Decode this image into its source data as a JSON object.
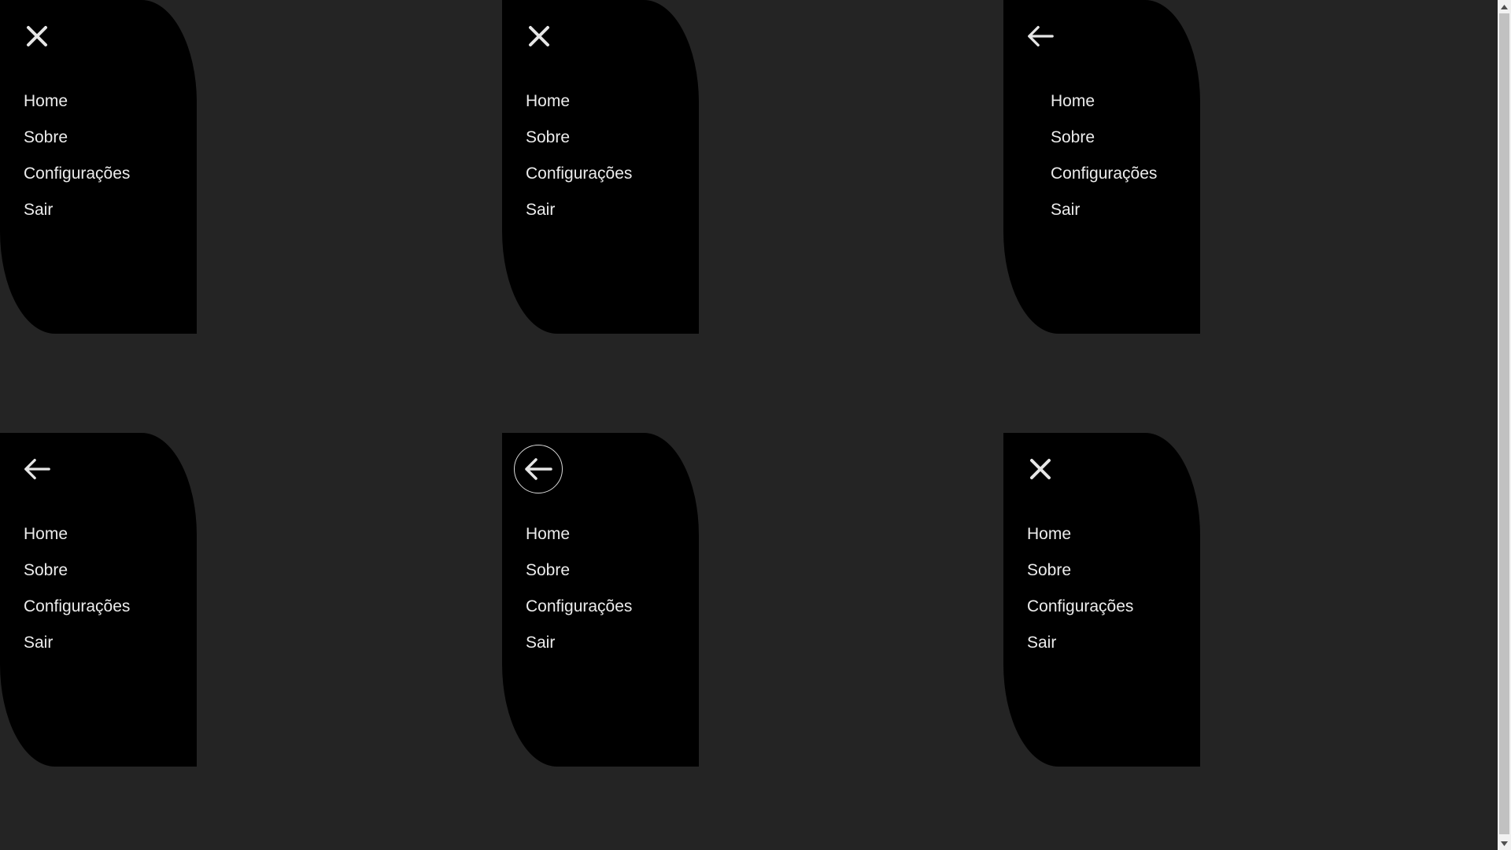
{
  "panels": [
    {
      "icon": "close-icon",
      "items": [
        "Home",
        "Sobre",
        "Configurações",
        "Sair"
      ]
    },
    {
      "icon": "close-icon",
      "items": [
        "Home",
        "Sobre",
        "Configurações",
        "Sair"
      ]
    },
    {
      "icon": "arrow-left-icon",
      "items": [
        "Home",
        "Sobre",
        "Configurações",
        "Sair"
      ]
    },
    {
      "icon": "arrow-left-icon",
      "items": [
        "Home",
        "Sobre",
        "Configurações",
        "Sair"
      ]
    },
    {
      "icon": "arrow-left-circle-icon",
      "items": [
        "Home",
        "Sobre",
        "Configurações",
        "Sair"
      ]
    },
    {
      "icon": "close-icon",
      "items": [
        "Home",
        "Sobre",
        "Configurações",
        "Sair"
      ]
    }
  ],
  "colors": {
    "background": "#242424",
    "panel": "#000000",
    "text": "#ececec",
    "icon": "#e6e6e6"
  }
}
